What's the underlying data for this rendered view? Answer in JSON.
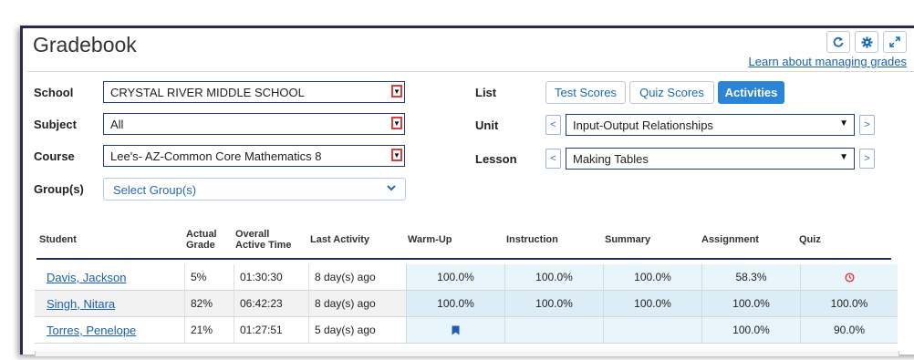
{
  "header": {
    "title": "Gradebook",
    "learn_link": "Learn about managing grades",
    "icons": [
      "refresh-icon",
      "gear-icon",
      "expand-icon"
    ]
  },
  "filters": {
    "school_label": "School",
    "school_value": "CRYSTAL RIVER MIDDLE SCHOOL",
    "subject_label": "Subject",
    "subject_value": "All",
    "course_label": "Course",
    "course_value": "Lee's- AZ-Common Core Mathematics 8",
    "groups_label": "Group(s)",
    "groups_placeholder": "Select Group(s)"
  },
  "list": {
    "label": "List",
    "tabs": [
      "Test Scores",
      "Quiz Scores",
      "Activities"
    ],
    "active_tab": "Activities"
  },
  "unit": {
    "label": "Unit",
    "value": "Input-Output Relationships",
    "prev": "<",
    "next": ">"
  },
  "lesson": {
    "label": "Lesson",
    "value": "Making Tables",
    "prev": "<",
    "next": ">"
  },
  "table": {
    "headers": {
      "student": "Student",
      "actual_grade": [
        "Actual",
        "Grade"
      ],
      "overall_active_time": [
        "Overall",
        "Active Time"
      ],
      "last_activity": "Last Activity",
      "warmup": "Warm-Up",
      "instruction": "Instruction",
      "summary": "Summary",
      "assignment": "Assignment",
      "quiz": "Quiz"
    },
    "rows": [
      {
        "student": "Davis, Jackson",
        "grade": "5%",
        "time": "01:30:30",
        "last": "8 day(s) ago",
        "warmup": "100.0%",
        "instruction": "100.0%",
        "summary": "100.0%",
        "assignment": "58.3%",
        "quiz": "",
        "quiz_icon": "clock-icon"
      },
      {
        "student": "Singh, Nitara",
        "grade": "82%",
        "time": "06:42:23",
        "last": "8 day(s) ago",
        "warmup": "100.0%",
        "instruction": "100.0%",
        "summary": "100.0%",
        "assignment": "100.0%",
        "quiz": "100.0%"
      },
      {
        "student": "Torres, Penelope",
        "grade": "21%",
        "time": "01:27:51",
        "last": "5 day(s) ago",
        "warmup": "",
        "warmup_icon": "bookmark-icon",
        "instruction": "",
        "summary": "",
        "assignment": "100.0%",
        "quiz": "90.0%"
      }
    ]
  },
  "colors": {
    "accent": "#2a84d8",
    "link": "#1a5fb4",
    "alert": "#e23b3b",
    "score_bg": "#e8f6fc"
  }
}
